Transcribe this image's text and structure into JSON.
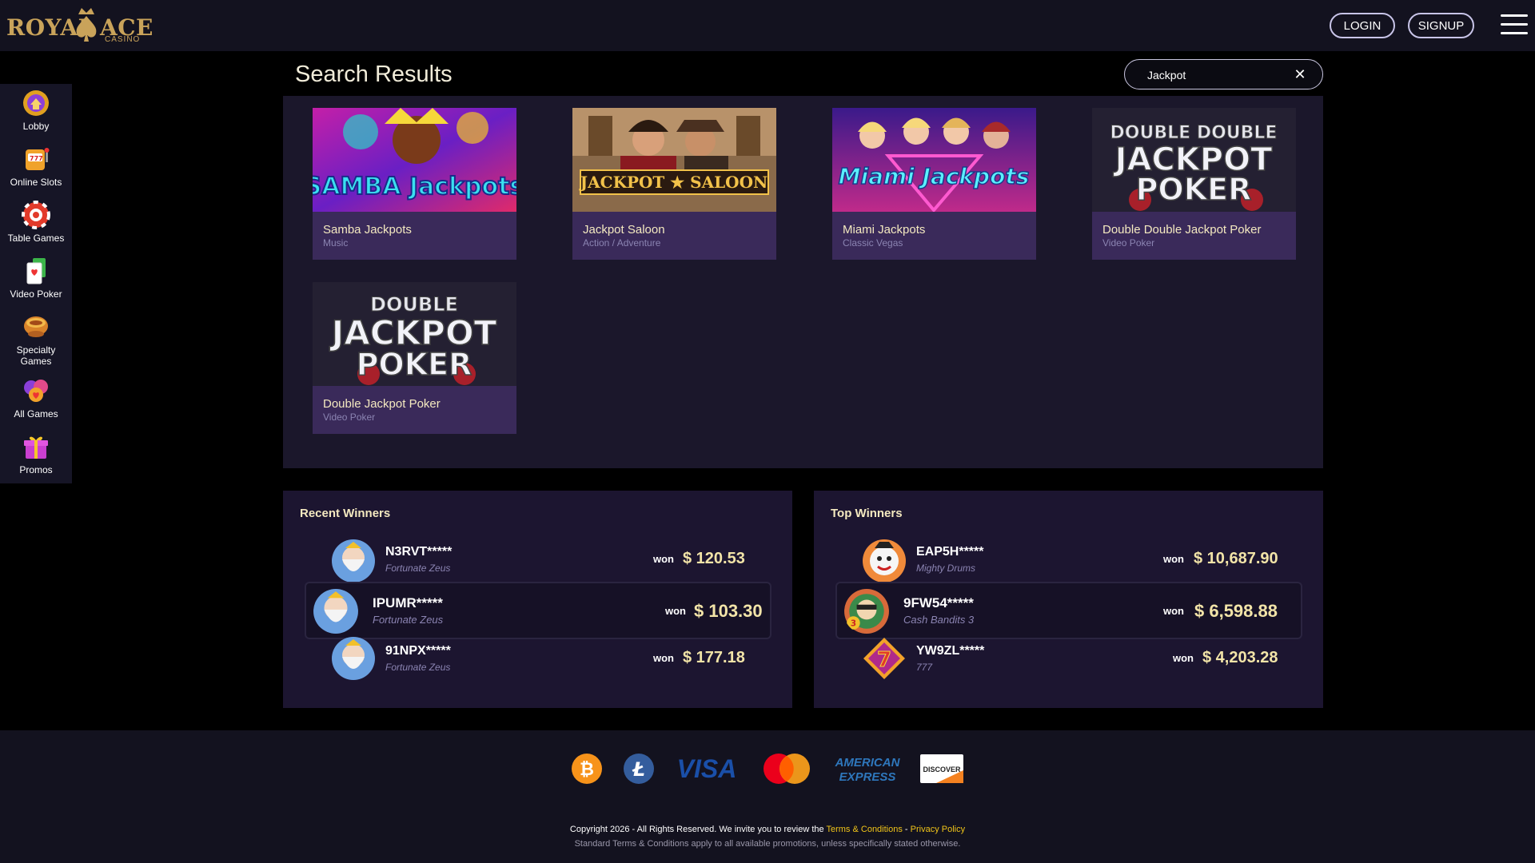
{
  "brand": {
    "word1": "ROYAL",
    "word2": "ACE",
    "sub": "CASINO",
    "gold": "#c9a35a"
  },
  "header": {
    "login": "LOGIN",
    "signup": "SIGNUP"
  },
  "sidebar": {
    "items": [
      {
        "label": "Lobby",
        "icon": "lobby-icon"
      },
      {
        "label": "Online Slots",
        "icon": "slot-machine-icon"
      },
      {
        "label": "Table Games",
        "icon": "roulette-chip-icon"
      },
      {
        "label": "Video Poker",
        "icon": "playing-cards-icon"
      },
      {
        "label": "Specialty Games",
        "icon": "specialty-bowl-icon"
      },
      {
        "label": "All Games",
        "icon": "all-games-icon"
      },
      {
        "label": "Promos",
        "icon": "gift-icon"
      }
    ]
  },
  "search": {
    "title": "Search Results",
    "value": "Jackpot"
  },
  "results": [
    {
      "title": "Samba Jackpots",
      "category": "Music",
      "art": "SAMBA Jackpots"
    },
    {
      "title": "Jackpot Saloon",
      "category": "Action / Adventure",
      "art": "JACKPOT ★ SALOON"
    },
    {
      "title": "Miami Jackpots",
      "category": "Classic Vegas",
      "art": "Miami Jackpots"
    },
    {
      "title": "Double Double Jackpot Poker",
      "category": "Video Poker",
      "art1": "DOUBLE DOUBLE",
      "art2": "JACKPOT",
      "art3": "POKER"
    },
    {
      "title": "Double Jackpot Poker",
      "category": "Video Poker",
      "art1": "DOUBLE",
      "art2": "JACKPOT",
      "art3": "POKER"
    }
  ],
  "recent_winners": {
    "title": "Recent Winners",
    "rows": [
      {
        "user": "N3RVT*****",
        "game": "Fortunate Zeus",
        "won": "won",
        "amount": "$ 120.53"
      },
      {
        "user": "IPUMR*****",
        "game": "Fortunate Zeus",
        "won": "won",
        "amount": "$ 103.30"
      },
      {
        "user": "91NPX*****",
        "game": "Fortunate Zeus",
        "won": "won",
        "amount": "$ 177.18"
      }
    ]
  },
  "top_winners": {
    "title": "Top Winners",
    "rows": [
      {
        "user": "EAP5H*****",
        "game": "Mighty Drums",
        "won": "won",
        "amount": "$ 10,687.90"
      },
      {
        "user": "9FW54*****",
        "game": "Cash Bandits 3",
        "won": "won",
        "amount": "$ 6,598.88"
      },
      {
        "user": "YW9ZL*****",
        "game": "777",
        "won": "won",
        "amount": "$ 4,203.28"
      }
    ]
  },
  "footer": {
    "payments": [
      "bitcoin-icon",
      "litecoin-icon",
      "visa-logo",
      "mastercard-logo",
      "american-express-logo",
      "discover-logo"
    ],
    "visa": "VISA",
    "amex1": "AMERICAN",
    "amex2": "EXPRESS",
    "discover": "DISCOVER",
    "copyright": "Copyright 2026 - All Rights Reserved. We invite you to review the",
    "terms_link": "Terms & Conditions",
    "sep": " - ",
    "privacy_link": "Privacy Policy",
    "note": "Standard Terms & Conditions apply to all available promotions, unless specifically stated otherwise."
  }
}
